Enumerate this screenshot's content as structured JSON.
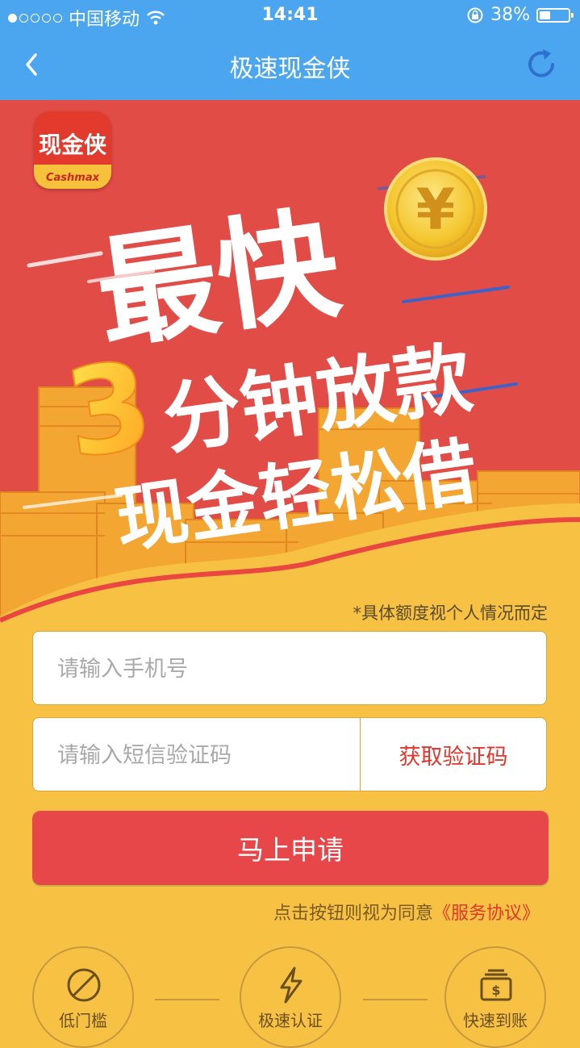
{
  "status": {
    "carrier": "中国移动",
    "time": "14:41",
    "battery": "38%",
    "battery_level": 0.38,
    "signal_bars": 1
  },
  "nav": {
    "title": "极速现金侠",
    "back_icon": "chevron-left-icon",
    "refresh_icon": "refresh-icon"
  },
  "banner": {
    "logo_text": "现金侠",
    "logo_sub": "Cashmax",
    "headline": "最快",
    "line2_number": "3",
    "line2_text": "分钟放款",
    "line3": "现金轻松借",
    "coin_symbol": "¥",
    "note": "*具体额度视个人情况而定"
  },
  "form": {
    "phone_placeholder": "请输入手机号",
    "code_placeholder": "请输入短信验证码",
    "get_code": "获取验证码",
    "submit": "马上申请",
    "agree_text": "点击按钮则视为同意",
    "agree_link": "《服务协议》"
  },
  "features": [
    {
      "label": "低门槛",
      "icon": "no-entry-icon"
    },
    {
      "label": "极速认证",
      "icon": "lightning-icon"
    },
    {
      "label": "快速到账",
      "icon": "money-stack-icon"
    }
  ],
  "colors": {
    "nav": "#4ba6ef",
    "banner_red": "#e24c46",
    "background": "#f7c244",
    "accent": "#e8474a"
  }
}
